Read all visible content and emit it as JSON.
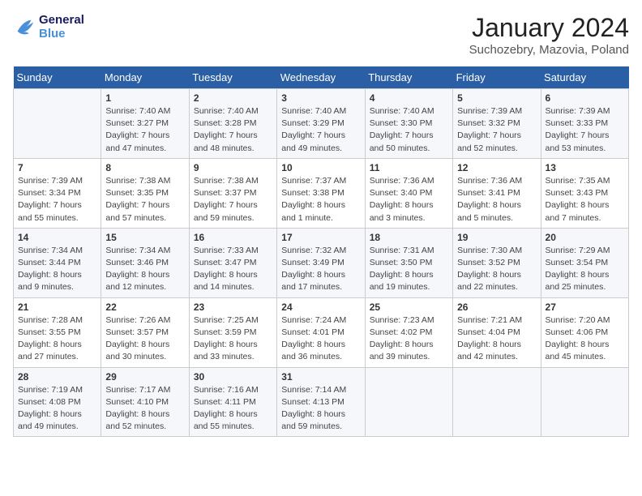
{
  "header": {
    "logo_line1": "General",
    "logo_line2": "Blue",
    "month": "January 2024",
    "location": "Suchozebry, Mazovia, Poland"
  },
  "weekdays": [
    "Sunday",
    "Monday",
    "Tuesday",
    "Wednesday",
    "Thursday",
    "Friday",
    "Saturday"
  ],
  "weeks": [
    [
      {
        "day": "",
        "info": ""
      },
      {
        "day": "1",
        "info": "Sunrise: 7:40 AM\nSunset: 3:27 PM\nDaylight: 7 hours\nand 47 minutes."
      },
      {
        "day": "2",
        "info": "Sunrise: 7:40 AM\nSunset: 3:28 PM\nDaylight: 7 hours\nand 48 minutes."
      },
      {
        "day": "3",
        "info": "Sunrise: 7:40 AM\nSunset: 3:29 PM\nDaylight: 7 hours\nand 49 minutes."
      },
      {
        "day": "4",
        "info": "Sunrise: 7:40 AM\nSunset: 3:30 PM\nDaylight: 7 hours\nand 50 minutes."
      },
      {
        "day": "5",
        "info": "Sunrise: 7:39 AM\nSunset: 3:32 PM\nDaylight: 7 hours\nand 52 minutes."
      },
      {
        "day": "6",
        "info": "Sunrise: 7:39 AM\nSunset: 3:33 PM\nDaylight: 7 hours\nand 53 minutes."
      }
    ],
    [
      {
        "day": "7",
        "info": "Sunrise: 7:39 AM\nSunset: 3:34 PM\nDaylight: 7 hours\nand 55 minutes."
      },
      {
        "day": "8",
        "info": "Sunrise: 7:38 AM\nSunset: 3:35 PM\nDaylight: 7 hours\nand 57 minutes."
      },
      {
        "day": "9",
        "info": "Sunrise: 7:38 AM\nSunset: 3:37 PM\nDaylight: 7 hours\nand 59 minutes."
      },
      {
        "day": "10",
        "info": "Sunrise: 7:37 AM\nSunset: 3:38 PM\nDaylight: 8 hours\nand 1 minute."
      },
      {
        "day": "11",
        "info": "Sunrise: 7:36 AM\nSunset: 3:40 PM\nDaylight: 8 hours\nand 3 minutes."
      },
      {
        "day": "12",
        "info": "Sunrise: 7:36 AM\nSunset: 3:41 PM\nDaylight: 8 hours\nand 5 minutes."
      },
      {
        "day": "13",
        "info": "Sunrise: 7:35 AM\nSunset: 3:43 PM\nDaylight: 8 hours\nand 7 minutes."
      }
    ],
    [
      {
        "day": "14",
        "info": "Sunrise: 7:34 AM\nSunset: 3:44 PM\nDaylight: 8 hours\nand 9 minutes."
      },
      {
        "day": "15",
        "info": "Sunrise: 7:34 AM\nSunset: 3:46 PM\nDaylight: 8 hours\nand 12 minutes."
      },
      {
        "day": "16",
        "info": "Sunrise: 7:33 AM\nSunset: 3:47 PM\nDaylight: 8 hours\nand 14 minutes."
      },
      {
        "day": "17",
        "info": "Sunrise: 7:32 AM\nSunset: 3:49 PM\nDaylight: 8 hours\nand 17 minutes."
      },
      {
        "day": "18",
        "info": "Sunrise: 7:31 AM\nSunset: 3:50 PM\nDaylight: 8 hours\nand 19 minutes."
      },
      {
        "day": "19",
        "info": "Sunrise: 7:30 AM\nSunset: 3:52 PM\nDaylight: 8 hours\nand 22 minutes."
      },
      {
        "day": "20",
        "info": "Sunrise: 7:29 AM\nSunset: 3:54 PM\nDaylight: 8 hours\nand 25 minutes."
      }
    ],
    [
      {
        "day": "21",
        "info": "Sunrise: 7:28 AM\nSunset: 3:55 PM\nDaylight: 8 hours\nand 27 minutes."
      },
      {
        "day": "22",
        "info": "Sunrise: 7:26 AM\nSunset: 3:57 PM\nDaylight: 8 hours\nand 30 minutes."
      },
      {
        "day": "23",
        "info": "Sunrise: 7:25 AM\nSunset: 3:59 PM\nDaylight: 8 hours\nand 33 minutes."
      },
      {
        "day": "24",
        "info": "Sunrise: 7:24 AM\nSunset: 4:01 PM\nDaylight: 8 hours\nand 36 minutes."
      },
      {
        "day": "25",
        "info": "Sunrise: 7:23 AM\nSunset: 4:02 PM\nDaylight: 8 hours\nand 39 minutes."
      },
      {
        "day": "26",
        "info": "Sunrise: 7:21 AM\nSunset: 4:04 PM\nDaylight: 8 hours\nand 42 minutes."
      },
      {
        "day": "27",
        "info": "Sunrise: 7:20 AM\nSunset: 4:06 PM\nDaylight: 8 hours\nand 45 minutes."
      }
    ],
    [
      {
        "day": "28",
        "info": "Sunrise: 7:19 AM\nSunset: 4:08 PM\nDaylight: 8 hours\nand 49 minutes."
      },
      {
        "day": "29",
        "info": "Sunrise: 7:17 AM\nSunset: 4:10 PM\nDaylight: 8 hours\nand 52 minutes."
      },
      {
        "day": "30",
        "info": "Sunrise: 7:16 AM\nSunset: 4:11 PM\nDaylight: 8 hours\nand 55 minutes."
      },
      {
        "day": "31",
        "info": "Sunrise: 7:14 AM\nSunset: 4:13 PM\nDaylight: 8 hours\nand 59 minutes."
      },
      {
        "day": "",
        "info": ""
      },
      {
        "day": "",
        "info": ""
      },
      {
        "day": "",
        "info": ""
      }
    ]
  ]
}
